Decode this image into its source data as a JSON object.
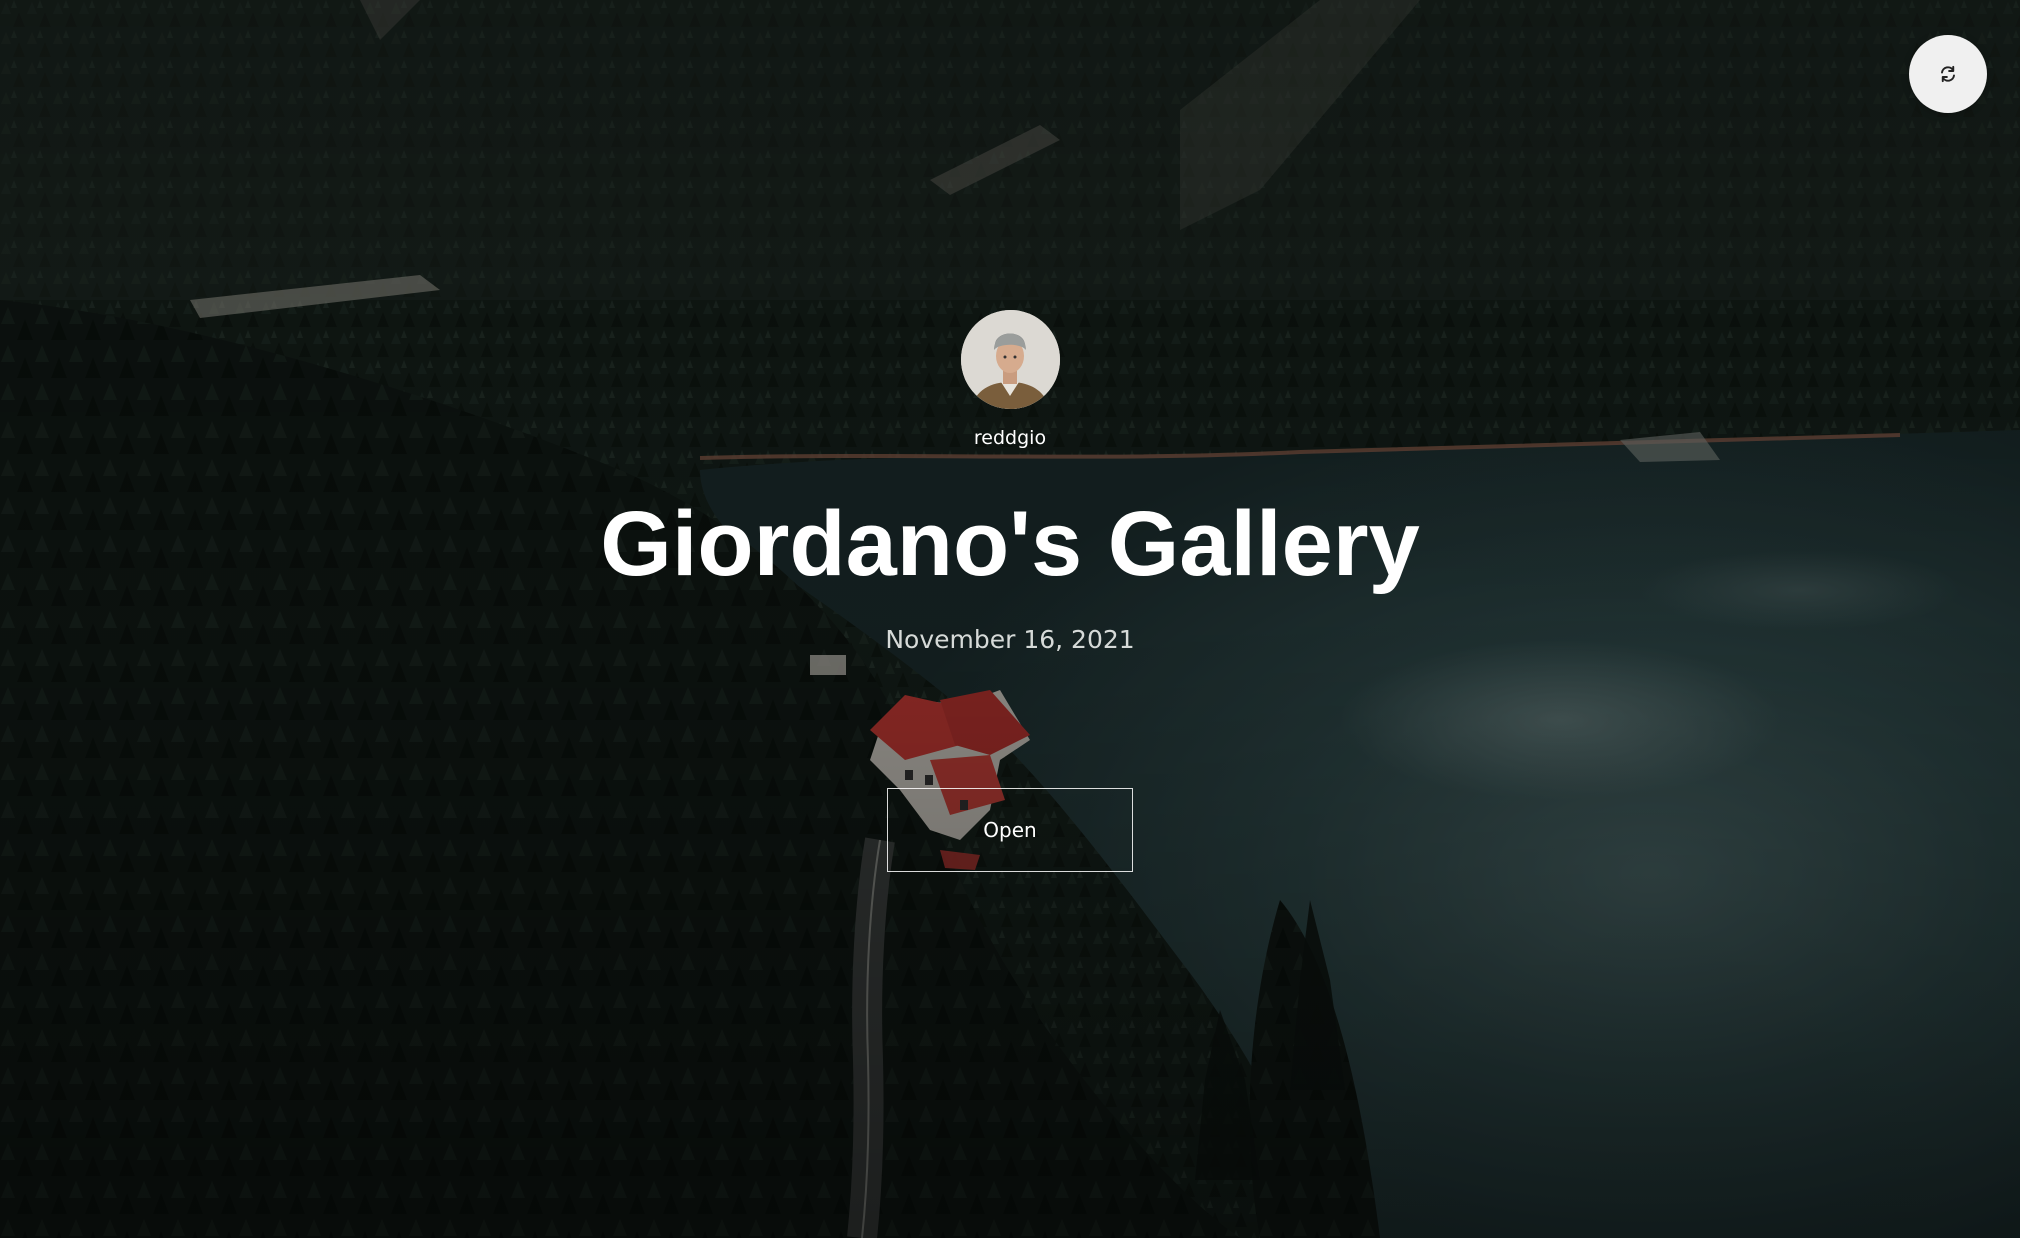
{
  "header": {
    "refresh_icon": "refresh-icon"
  },
  "profile": {
    "username": "reddgio",
    "avatar_icon": "user-avatar"
  },
  "gallery": {
    "title": "Giordano's Gallery",
    "date": "November 16, 2021",
    "open_label": "Open"
  },
  "colors": {
    "forest": "#1a2620",
    "lake": "#2f4a4b",
    "roof": "#c23a34",
    "text": "#ffffff"
  }
}
